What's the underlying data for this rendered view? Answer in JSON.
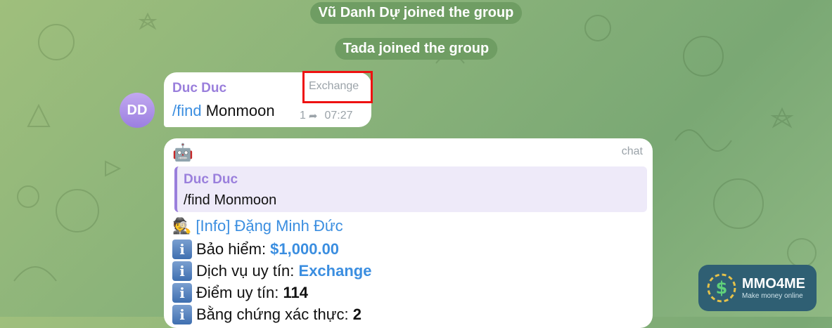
{
  "service_messages": [
    "Vũ Danh Dự joined the group",
    "Tada joined the group"
  ],
  "message1": {
    "avatar_initials": "DD",
    "sender": "Duc Duc",
    "command": "/find",
    "text": "Monmoon",
    "tag": "Exchange",
    "replies": "1",
    "time": "07:27"
  },
  "message2": {
    "bot_icon": "🤖",
    "tag": "chat",
    "quote_sender": "Duc Duc",
    "quote_text": "/find Monmoon",
    "info_icon": "🕵️",
    "info_label": "[Info]",
    "info_name": "Đặng Minh Đức",
    "lines": [
      {
        "label": "Bảo hiểm: ",
        "value": "$1,000.00"
      },
      {
        "label": "Dịch vụ uy tín: ",
        "value": "Exchange"
      },
      {
        "label": "Điểm uy tín: ",
        "value": "114"
      },
      {
        "label": "Bằng chứng xác thực: ",
        "value": "2"
      }
    ]
  },
  "logo": {
    "name": "MMO4ME",
    "tagline": "Make money online"
  },
  "colors": {
    "accent": "#3b8ee0",
    "sender": "#9a7fdc",
    "highlight": "#ee1111"
  }
}
